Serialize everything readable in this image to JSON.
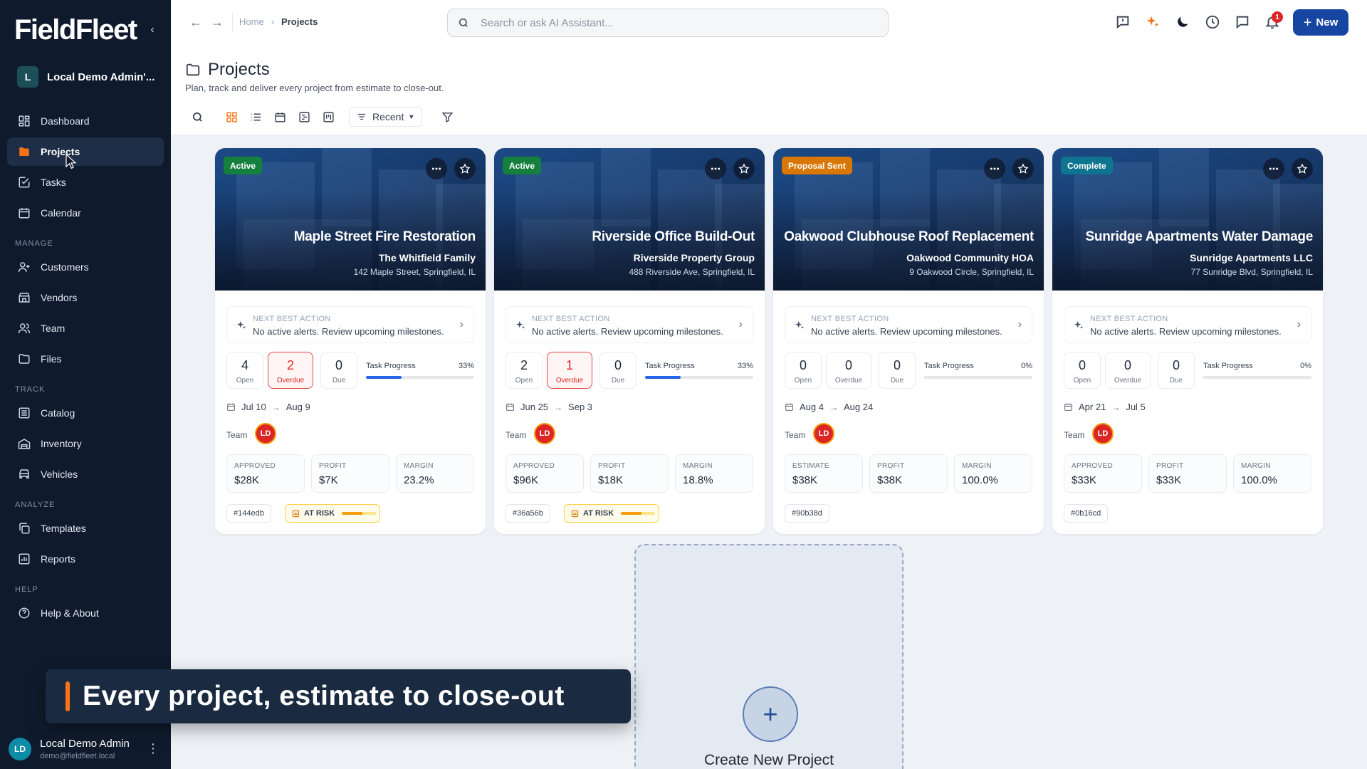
{
  "app": {
    "logo": "FieldFleet",
    "org_initial": "L",
    "org_name": "Local Demo Admin'..."
  },
  "nav": {
    "dashboard": "Dashboard",
    "projects": "Projects",
    "tasks": "Tasks",
    "calendar": "Calendar",
    "section_manage": "MANAGE",
    "customers": "Customers",
    "vendors": "Vendors",
    "team": "Team",
    "files": "Files",
    "section_track": "TRACK",
    "catalog": "Catalog",
    "inventory": "Inventory",
    "vehicles": "Vehicles",
    "section_analyze": "ANALYZE",
    "templates": "Templates",
    "reports": "Reports",
    "section_help": "HELP",
    "help": "Help & About"
  },
  "user": {
    "initials": "LD",
    "name": "Local Demo Admin",
    "email": "demo@fieldfleet.local"
  },
  "topbar": {
    "breadcrumb_home": "Home",
    "breadcrumb_current": "Projects",
    "search_placeholder": "Search or ask AI Assistant...",
    "notification_count": "1",
    "new_label": "New"
  },
  "page": {
    "title": "Projects",
    "subtitle": "Plan, track and deliver every project from estimate to close-out.",
    "sort_label": "Recent"
  },
  "colors": {
    "active": "#15803d",
    "proposal_sent": "#d97706",
    "complete": "#0e7490",
    "accent": "#1746a2"
  },
  "cards": [
    {
      "status": "Active",
      "title": "Maple Street Fire Restoration",
      "customer": "The Whitfield Family",
      "address": "142 Maple Street, Springfield, IL",
      "nba_label": "NEXT BEST ACTION",
      "nba_text": "No active alerts. Review upcoming milestones.",
      "open": "4",
      "open_label": "Open",
      "overdue": "2",
      "overdue_label": "Overdue",
      "due": "0",
      "due_label": "Due",
      "progress_label": "Task Progress",
      "progress_pct": "33%",
      "progress_value": 0.33,
      "date_start": "Jul 10",
      "date_end": "Aug 9",
      "team_label": "Team",
      "team_initials": "LD",
      "m1_label": "APPROVED",
      "m1_value": "$28K",
      "m2_label": "PROFIT",
      "m2_value": "$7K",
      "m3_label": "MARGIN",
      "m3_value": "23.2%",
      "code": "#144edb",
      "risk": "AT RISK"
    },
    {
      "status": "Active",
      "title": "Riverside Office Build-Out",
      "customer": "Riverside Property Group",
      "address": "488 Riverside Ave, Springfield, IL",
      "nba_label": "NEXT BEST ACTION",
      "nba_text": "No active alerts. Review upcoming milestones.",
      "open": "2",
      "open_label": "Open",
      "overdue": "1",
      "overdue_label": "Overdue",
      "due": "0",
      "due_label": "Due",
      "progress_label": "Task Progress",
      "progress_pct": "33%",
      "progress_value": 0.33,
      "date_start": "Jun 25",
      "date_end": "Sep 3",
      "team_label": "Team",
      "team_initials": "LD",
      "m1_label": "APPROVED",
      "m1_value": "$96K",
      "m2_label": "PROFIT",
      "m2_value": "$18K",
      "m3_label": "MARGIN",
      "m3_value": "18.8%",
      "code": "#36a56b",
      "risk": "AT RISK"
    },
    {
      "status": "Proposal Sent",
      "title": "Oakwood Clubhouse Roof Replacement",
      "customer": "Oakwood Community HOA",
      "address": "9 Oakwood Circle, Springfield, IL",
      "nba_label": "NEXT BEST ACTION",
      "nba_text": "No active alerts. Review upcoming milestones.",
      "open": "0",
      "open_label": "Open",
      "overdue": "0",
      "overdue_label": "Overdue",
      "due": "0",
      "due_label": "Due",
      "progress_label": "Task Progress",
      "progress_pct": "0%",
      "progress_value": 0,
      "date_start": "Aug 4",
      "date_end": "Aug 24",
      "team_label": "Team",
      "team_initials": "LD",
      "m1_label": "ESTIMATE",
      "m1_value": "$38K",
      "m2_label": "PROFIT",
      "m2_value": "$38K",
      "m3_label": "MARGIN",
      "m3_value": "100.0%",
      "code": "#90b38d"
    },
    {
      "status": "Complete",
      "title": "Sunridge Apartments Water Damage",
      "customer": "Sunridge Apartments LLC",
      "address": "77 Sunridge Blvd, Springfield, IL",
      "nba_label": "NEXT BEST ACTION",
      "nba_text": "No active alerts. Review upcoming milestones.",
      "open": "0",
      "open_label": "Open",
      "overdue": "0",
      "overdue_label": "Overdue",
      "due": "0",
      "due_label": "Due",
      "progress_label": "Task Progress",
      "progress_pct": "0%",
      "progress_value": 0,
      "date_start": "Apr 21",
      "date_end": "Jul 5",
      "team_label": "Team",
      "team_initials": "LD",
      "m1_label": "APPROVED",
      "m1_value": "$33K",
      "m2_label": "PROFIT",
      "m2_value": "$33K",
      "m3_label": "MARGIN",
      "m3_value": "100.0%",
      "code": "#0b16cd"
    }
  ],
  "create": {
    "label": "Create New Project"
  },
  "caption": {
    "text": "Every project, estimate to close-out"
  }
}
